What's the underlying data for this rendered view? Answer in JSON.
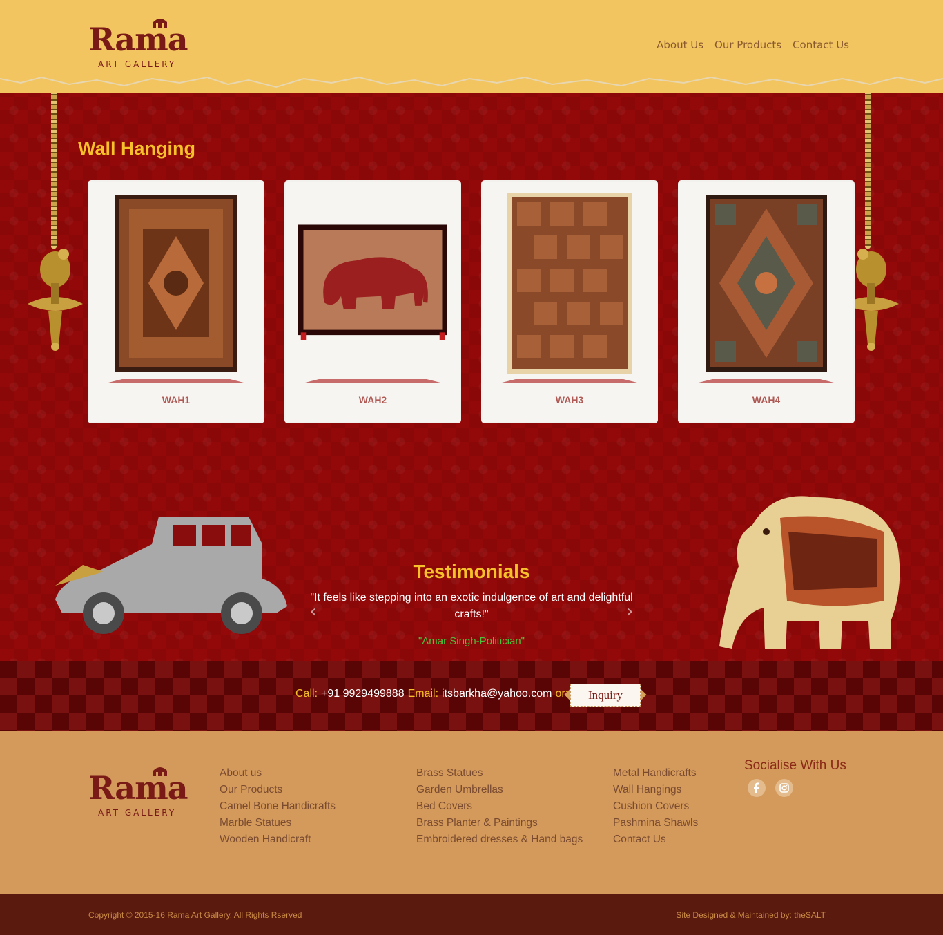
{
  "header": {
    "logo_word": "Rama",
    "logo_sub": "ART GALLERY",
    "nav": [
      "About Us",
      "Our Products",
      "Contact Us"
    ]
  },
  "gallery": {
    "title": "Wall Hanging",
    "items": [
      {
        "label": "WAH1",
        "kind": "rug-rect"
      },
      {
        "label": "WAH2",
        "kind": "elephant-tapestry"
      },
      {
        "label": "WAH3",
        "kind": "patchwork"
      },
      {
        "label": "WAH4",
        "kind": "rug-mosaic"
      }
    ]
  },
  "testimonials": {
    "title": "Testimonials",
    "quote": "\"It feels like stepping into an exotic indulgence of art and delightful crafts!\"",
    "author": "\"Amar Singh-Politician\"",
    "prev_icon": "chevron-left-icon",
    "next_icon": "chevron-right-icon"
  },
  "contact": {
    "call_label": "Call:",
    "phone": "+91 9929499888",
    "email_label": "Email:",
    "email": "itsbarkha@yahoo.com",
    "or_label": "or:",
    "inquiry_label": "Inquiry"
  },
  "footer": {
    "col1": [
      "About us",
      "Our Products",
      "Camel Bone Handicrafts",
      "Marble Statues",
      "Wooden Handicraft"
    ],
    "col2": [
      "Brass Statues",
      "Garden Umbrellas",
      "Bed Covers",
      "Brass Planter & Paintings",
      "Embroidered dresses & Hand bags"
    ],
    "col3": [
      "Metal Handicrafts",
      "Wall Hangings",
      "Cushion Covers",
      "Pashmina Shawls",
      "Contact Us"
    ],
    "social_title": "Socialise With Us",
    "social_icons": [
      "facebook-icon",
      "instagram-icon"
    ],
    "copyright": "Copyright © 2015-16 Rama Art Gallery, All Rights Rserved",
    "credit": "Site Designed & Maintained by: theSALT"
  },
  "colors": {
    "header_bg": "#f2c560",
    "red_bg": "#930808",
    "accent_yellow": "#f6c02a",
    "footer_bg": "#d39a5c",
    "copyright_bg": "#5a1a0e"
  }
}
